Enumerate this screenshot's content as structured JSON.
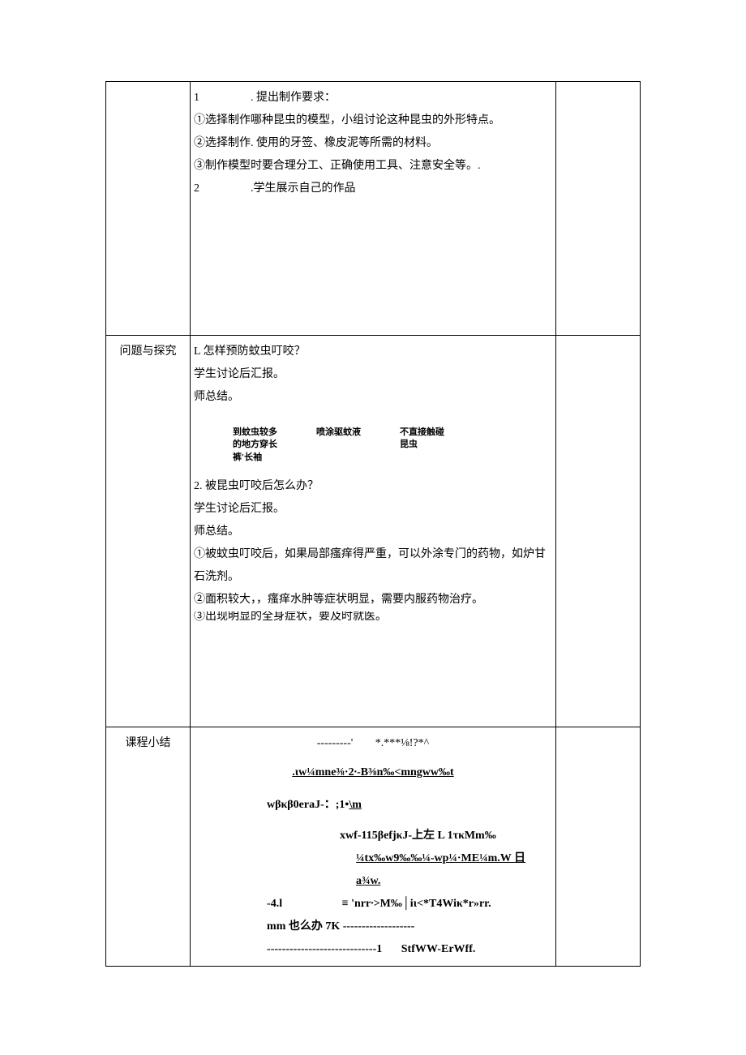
{
  "row1": {
    "label": "",
    "line1_num": "1",
    "line1_text": ". 提出制作要求：",
    "bullet1": "①选择制作哪种昆虫的模型，小组讨论这种昆虫的外形特点。",
    "bullet2": "②选择制作. 使用的牙签、橡皮泥等所需的材料。",
    "bullet3": "③制作模型时要合理分工、正确使用工具、注意安全等。.",
    "line2_num": "2",
    "line2_text": ".学生展示自己的作品"
  },
  "row2": {
    "label": "问题与探究",
    "q1": "L 怎样预防蚊虫叮咬？",
    "discuss1": "学生讨论后汇报。",
    "teacher1": "师总结。",
    "tip1a": "到蚊虫较多",
    "tip1b": "的地方穿长",
    "tip1c": "裤'长袖",
    "tip2": "喷涂驱蚊液",
    "tip3a": "不直接触碰",
    "tip3b": "昆虫",
    "q2": "2. 被昆虫叮咬后怎么办？",
    "discuss2": "学生讨论后汇报。",
    "teacher2": "师总结。",
    "ans1": "①被蚊虫叮咬后，如果局部瘙痒得严重，可以外涂专门的药物，如炉甘石洗剂。",
    "ans2": "②面积较大，，瘙痒水肿等症状明显，需要内服药物治疗。",
    "cutoff": "③出现明显的全身症状，要及时就医。"
  },
  "row3": {
    "label": "课程小结",
    "g1a": "---------'",
    "g1b": "*.***⅛!?*^",
    "g2": ".ιw¼mne⅜·2∙-B⅜n‰<mngww‰t",
    "g3a": "wβκβ0eraJ-：;1•",
    "g3b": "\\m",
    "g4": "xwf-115βefjκJ-上左 L      1τκMm‰",
    "g5": "¼tx‰w9‰‰¼-wp¼·ME¼m.W 日 a¾w.",
    "g6a": "-4.l",
    "g6b": "≡ 'nrr∙>M‰│iι<*T4Wiκ*r»rr.",
    "g7": "mm 也么办 7K -------------------",
    "g8a": "-----------------------------1",
    "g8b": "StfWW-ErWff."
  }
}
